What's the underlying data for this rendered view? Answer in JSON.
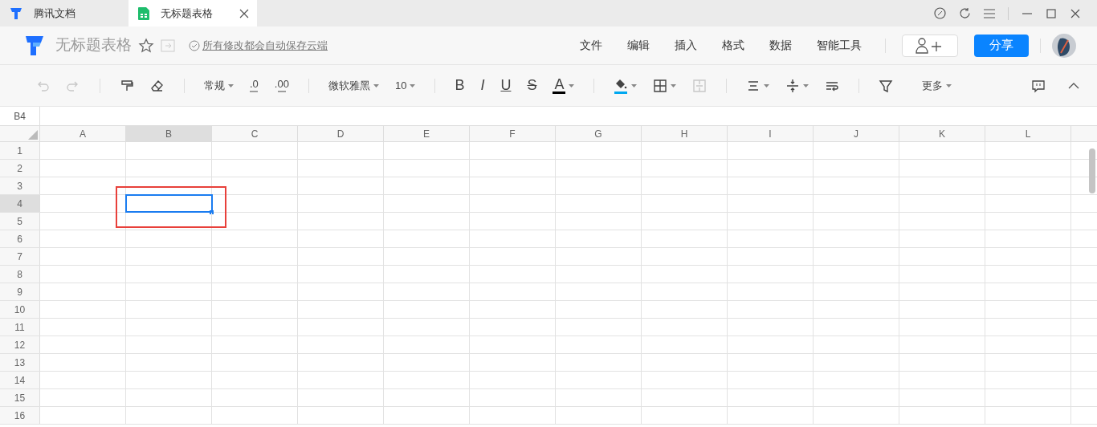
{
  "tabs": [
    {
      "label": "腾讯文档",
      "kind": "docs",
      "selected": false
    },
    {
      "label": "无标题表格",
      "kind": "sheet",
      "selected": true
    }
  ],
  "header": {
    "title": "无标题表格",
    "save_note": "所有修改都会自动保存云端"
  },
  "menu": [
    "文件",
    "编辑",
    "插入",
    "格式",
    "数据",
    "智能工具"
  ],
  "share_button": "分享",
  "toolbar": [
    {
      "kind": "undo",
      "disabled": true
    },
    {
      "kind": "redo",
      "disabled": true
    },
    {
      "kind": "sep"
    },
    {
      "kind": "painter",
      "disabled": false
    },
    {
      "kind": "eraser",
      "disabled": false
    },
    {
      "kind": "sep"
    },
    {
      "kind": "select",
      "label": "常规",
      "disabled": false
    },
    {
      "kind": "decimal",
      "label": ".0",
      "disabled": false
    },
    {
      "kind": "decimal",
      "label": ".00",
      "disabled": false
    },
    {
      "kind": "sep"
    },
    {
      "kind": "select",
      "label": "微软雅黑",
      "disabled": false
    },
    {
      "kind": "select",
      "label": "10",
      "disabled": false
    },
    {
      "kind": "sep"
    },
    {
      "kind": "bold",
      "label": "B",
      "disabled": false
    },
    {
      "kind": "italic",
      "label": "I",
      "disabled": false
    },
    {
      "kind": "underline",
      "label": "U",
      "disabled": false
    },
    {
      "kind": "strike",
      "label": "S",
      "disabled": false
    },
    {
      "kind": "fontcolor",
      "label": "A",
      "color": "#000000",
      "disabled": false
    },
    {
      "kind": "sep"
    },
    {
      "kind": "fill",
      "color": "#00a8f0",
      "disabled": false
    },
    {
      "kind": "border",
      "disabled": false
    },
    {
      "kind": "merge",
      "disabled": true
    },
    {
      "kind": "sep"
    },
    {
      "kind": "align",
      "disabled": false
    },
    {
      "kind": "valign",
      "disabled": false
    },
    {
      "kind": "wrap",
      "disabled": false
    },
    {
      "kind": "sep"
    },
    {
      "kind": "filter",
      "disabled": false
    },
    {
      "kind": "select",
      "label": "更多",
      "disabled": false
    }
  ],
  "name_box": "B4",
  "columns": [
    {
      "label": "A",
      "selected": false
    },
    {
      "label": "B",
      "selected": true
    },
    {
      "label": "C",
      "selected": false
    },
    {
      "label": "D",
      "selected": false
    },
    {
      "label": "E",
      "selected": false
    },
    {
      "label": "F",
      "selected": false
    },
    {
      "label": "G",
      "selected": false
    },
    {
      "label": "H",
      "selected": false
    },
    {
      "label": "I",
      "selected": false
    },
    {
      "label": "J",
      "selected": false
    },
    {
      "label": "K",
      "selected": false
    },
    {
      "label": "L",
      "selected": false
    }
  ],
  "rows": [
    {
      "label": "1",
      "selected": false
    },
    {
      "label": "2",
      "selected": false
    },
    {
      "label": "3",
      "selected": false
    },
    {
      "label": "4",
      "selected": true
    },
    {
      "label": "5",
      "selected": false
    },
    {
      "label": "6",
      "selected": false
    },
    {
      "label": "7",
      "selected": false
    },
    {
      "label": "8",
      "selected": false
    },
    {
      "label": "9",
      "selected": false
    },
    {
      "label": "10",
      "selected": false
    },
    {
      "label": "11",
      "selected": false
    },
    {
      "label": "12",
      "selected": false
    },
    {
      "label": "13",
      "selected": false
    },
    {
      "label": "14",
      "selected": false
    },
    {
      "label": "15",
      "selected": false
    },
    {
      "label": "16",
      "selected": false
    }
  ]
}
